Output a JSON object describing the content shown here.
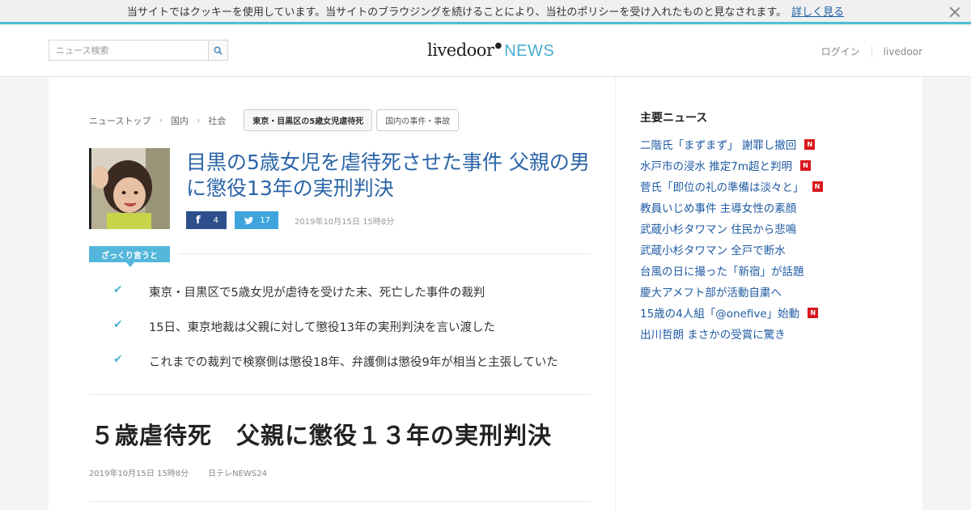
{
  "cookie": {
    "message": "当サイトではクッキーを使用しています。当サイトのブラウジングを続けることにより、当社のポリシーを受け入れたものと見なされます。",
    "link": "詳しく見る"
  },
  "header": {
    "search_placeholder": "ニュース検索",
    "logo_main": "livedoor",
    "logo_news": "NEWS",
    "login": "ログイン",
    "livedoor": "livedoor"
  },
  "breadcrumb": [
    {
      "label": "ニューストップ"
    },
    {
      "label": "国内"
    },
    {
      "label": "社会"
    }
  ],
  "tags": [
    {
      "label": "東京・目黒区の5歳女児虐待死"
    },
    {
      "label": "国内の事件・事故"
    }
  ],
  "article": {
    "title": "目黒の5歳女児を虐待死させた事件 父親の男に懲役13年の実刑判決",
    "fb_count": "4",
    "tw_count": "17",
    "date": "2019年10月15日 15時8分",
    "summary_label": "ざっくり言うと",
    "points": [
      "東京・目黒区で5歳女児が虐待を受けた末、死亡した事件の裁判",
      "15日、東京地裁は父親に対して懲役13年の実刑判決を言い渡した",
      "これまでの裁判で検察側は懲役18年、弁護側は懲役9年が相当と主張していた"
    ],
    "headline": "５歳虐待死　父親に懲役１３年の実刑判決",
    "meta_date": "2019年10月15日 15時8分",
    "source": "日テレNEWS24"
  },
  "sidebar": {
    "title": "主要ニュース",
    "items": [
      {
        "label": "二階氏「まずまず」 謝罪し撤回",
        "new": true
      },
      {
        "label": "水戸市の浸水 推定7m超と判明",
        "new": true
      },
      {
        "label": "菅氏「即位の礼の準備は淡々と」",
        "new": true
      },
      {
        "label": "教員いじめ事件 主導女性の素顔",
        "new": false
      },
      {
        "label": "武蔵小杉タワマン 住民から悲鳴",
        "new": false
      },
      {
        "label": "武蔵小杉タワマン 全戸で断水",
        "new": false
      },
      {
        "label": "台風の日に撮った「新宿」が話題",
        "new": false
      },
      {
        "label": "慶大アメフト部が活動自粛へ",
        "new": false
      },
      {
        "label": "15歳の4人組「@onefive」始動",
        "new": true
      },
      {
        "label": "出川哲朗 まさかの受賞に驚き",
        "new": false
      }
    ],
    "badge_text": "N"
  },
  "colors": {
    "accent": "#4fbfd6",
    "title_blue": "#2a64a8",
    "link_blue": "#1f5ba3",
    "facebook": "#2d4f8c",
    "twitter": "#3fa4dd",
    "new_badge": "#d7191d"
  },
  "icons": {
    "search": "search-icon",
    "close": "close-icon",
    "check": "check-icon",
    "facebook": "facebook-icon",
    "twitter": "twitter-icon"
  }
}
